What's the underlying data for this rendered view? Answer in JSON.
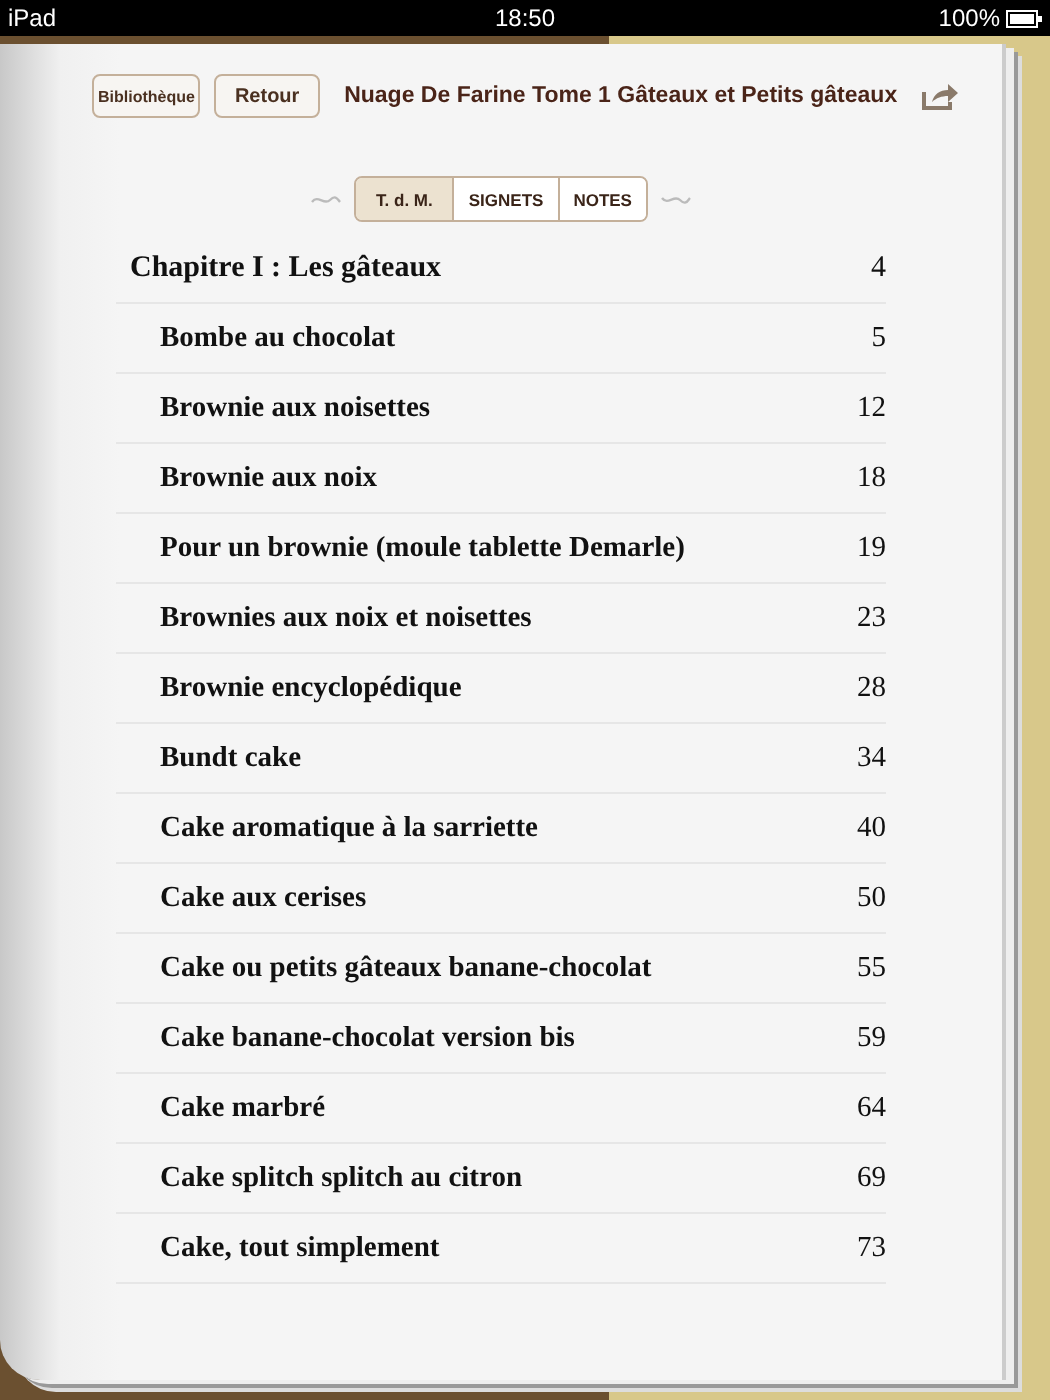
{
  "status_bar": {
    "device": "iPad",
    "time": "18:50",
    "battery": "100%"
  },
  "toolbar": {
    "buttons": [
      "Bibliothèque",
      "Retour"
    ],
    "title": "Nuage De Farine Tome 1 Gâteaux et Petits gâteaux"
  },
  "tabs": [
    {
      "label": "T. d. M.",
      "selected": true
    },
    {
      "label": "SIGNETS",
      "selected": false
    },
    {
      "label": "NOTES",
      "selected": false
    }
  ],
  "toc": [
    {
      "title": "Chapitre I : Les gâteaux",
      "page": "4",
      "children": [
        {
          "title": "Bombe au chocolat",
          "page": "5"
        },
        {
          "title": "Brownie aux noisettes",
          "page": "12"
        },
        {
          "title": "Brownie aux noix",
          "page": "18"
        },
        {
          "title": "Pour un brownie (moule tablette Demarle)",
          "page": "19"
        },
        {
          "title": "Brownies aux noix et noisettes",
          "page": "23"
        },
        {
          "title": "Brownie encyclopédique",
          "page": "28"
        },
        {
          "title": "Bundt cake",
          "page": "34"
        },
        {
          "title": "Cake aromatique à la sarriette",
          "page": "40"
        },
        {
          "title": "Cake aux cerises",
          "page": "50"
        },
        {
          "title": "Cake ou petits gâteaux banane-chocolat",
          "page": "55"
        },
        {
          "title": "Cake banane-chocolat version bis",
          "page": "59"
        },
        {
          "title": "Cake marbré",
          "page": "64"
        },
        {
          "title": "Cake splitch splitch au citron",
          "page": "69"
        },
        {
          "title": "Cake, tout simplement",
          "page": "73"
        }
      ]
    }
  ]
}
